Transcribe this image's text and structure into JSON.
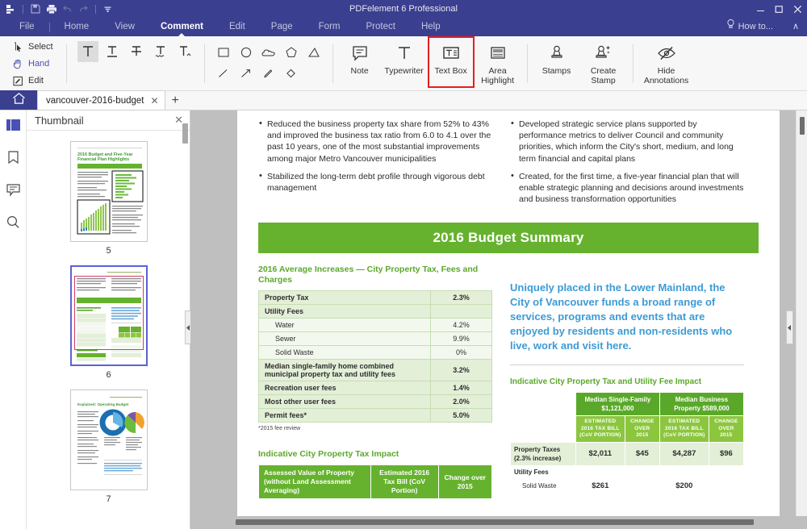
{
  "window": {
    "title": "PDFelement 6 Professional",
    "minimize": "–",
    "maximize": "☐",
    "close": "✕"
  },
  "quick_access": {
    "app_icon": "pdfelement-logo-icon",
    "save_icon": "save-icon",
    "print_icon": "print-icon",
    "undo_icon": "undo-icon",
    "redo_icon": "redo-icon",
    "customize_icon": "customize-quick-access-icon"
  },
  "menu": {
    "items": [
      {
        "label": "File",
        "active": false
      },
      {
        "label": "Home",
        "active": false
      },
      {
        "label": "View",
        "active": false
      },
      {
        "label": "Comment",
        "active": true
      },
      {
        "label": "Edit",
        "active": false
      },
      {
        "label": "Page",
        "active": false
      },
      {
        "label": "Form",
        "active": false
      },
      {
        "label": "Protect",
        "active": false
      },
      {
        "label": "Help",
        "active": false
      }
    ],
    "how_to": "How to...",
    "collapse_ribbon": "∧"
  },
  "ribbon": {
    "select_tools": [
      {
        "label": "Select",
        "icon": "cursor-select-icon",
        "active": false
      },
      {
        "label": "Hand",
        "icon": "hand-icon",
        "active": true
      },
      {
        "label": "Edit",
        "icon": "edit-pencil-icon",
        "active": false
      }
    ],
    "markup_tools": [
      {
        "icon": "highlight-text-icon",
        "selected": true
      },
      {
        "icon": "underline-text-icon",
        "selected": false
      },
      {
        "icon": "strikethrough-text-icon",
        "selected": false
      },
      {
        "icon": "squiggly-underline-icon",
        "selected": false
      },
      {
        "icon": "caret-insert-text-icon",
        "selected": false
      }
    ],
    "shape_tools": [
      {
        "icon": "rectangle-icon"
      },
      {
        "icon": "ellipse-icon"
      },
      {
        "icon": "cloud-icon"
      },
      {
        "icon": "polygon-icon"
      },
      {
        "icon": "open-polygon-icon"
      },
      {
        "icon": "line-icon"
      },
      {
        "icon": "arrow-icon"
      },
      {
        "icon": "pencil-draw-icon"
      },
      {
        "icon": "eraser-icon"
      }
    ],
    "buttons": [
      {
        "label": "Note",
        "icon": "sticky-note-icon",
        "highlighted": false
      },
      {
        "label": "Typewriter",
        "icon": "typewriter-icon",
        "highlighted": false
      },
      {
        "label": "Text Box",
        "icon": "text-box-icon",
        "highlighted": true
      },
      {
        "label": "Area\nHighlight",
        "icon": "area-highlight-icon",
        "highlighted": false
      },
      {
        "label": "Stamps",
        "icon": "stamp-icon",
        "highlighted": false
      },
      {
        "label": "Create\nStamp",
        "icon": "create-stamp-icon",
        "highlighted": false
      },
      {
        "label": "Hide\nAnnotations",
        "icon": "hide-annotations-icon",
        "highlighted": false
      }
    ],
    "accent_highlight_color": "#e81d1d"
  },
  "tabs": {
    "home_icon": "home-icon",
    "document_tab": "vancouver-2016-budget",
    "close_tab": "✕",
    "new_tab": "+"
  },
  "rail": {
    "items": [
      {
        "icon": "thumbnail-panel-icon",
        "active": true
      },
      {
        "icon": "bookmark-icon",
        "active": false
      },
      {
        "icon": "annotation-comment-icon",
        "active": false
      },
      {
        "icon": "search-icon",
        "active": false
      }
    ]
  },
  "thumbnail_panel": {
    "title": "Thumbnail",
    "close": "✕",
    "pages": [
      {
        "number": "5",
        "selected": false
      },
      {
        "number": "6",
        "selected": true
      },
      {
        "number": "7",
        "selected": false
      }
    ]
  },
  "document": {
    "left_bullets": [
      "Reduced the business property tax share from 52% to 43% and improved the business tax ratio from 6.0 to 4.1 over the past 10 years, one of the most substantial improvements among major Metro Vancouver municipalities",
      "Stabilized the long-term debt profile through vigorous debt management"
    ],
    "right_bullets": [
      "Developed strategic service plans supported by performance metrics to deliver Council and community priorities, which inform the City's short, medium, and long term financial and capital plans",
      "Created, for the first time, a five-year financial plan that will enable strategic planning and decisions around investments and business transformation opportunities"
    ],
    "banner_title": "2016 Budget Summary",
    "avg_increases": {
      "heading": "2016 Average Increases — City Property Tax, Fees and Charges",
      "rows": [
        {
          "label": "Property Tax",
          "value": "2.3%",
          "style": "lt"
        },
        {
          "label": "Utility Fees",
          "value": "",
          "style": "lt"
        },
        {
          "label": "Water",
          "value": "4.2%",
          "style": "wh"
        },
        {
          "label": "Sewer",
          "value": "9.9%",
          "style": "wh"
        },
        {
          "label": "Solid Waste",
          "value": "0%",
          "style": "wh"
        },
        {
          "label": "Median single-family home combined municipal property tax and utility fees",
          "value": "3.2%",
          "style": "lt"
        },
        {
          "label": "Recreation user fees",
          "value": "1.4%",
          "style": "lt"
        },
        {
          "label": "Most other user fees",
          "value": "2.0%",
          "style": "lt"
        },
        {
          "label": "Permit fees*",
          "value": "5.0%",
          "style": "lt"
        }
      ],
      "footnote": "*2015 fee review"
    },
    "quote": "Uniquely placed in the Lower Mainland, the City of Vancouver funds a broad range of services, programs and events that are enjoyed by residents and non-residents who live, work and visit here.",
    "impact_table": {
      "heading": "Indicative City Property Tax and Utility Fee Impact",
      "group_headers": [
        "Median Single-Family $1,121,000",
        "Median Business Property $589,000"
      ],
      "sub_headers": [
        "ESTIMATED 2016 TAX BILL (CoV PORTION)",
        "CHANGE OVER 2015",
        "ESTIMATED 2016 TAX BILL (CoV PORTION)",
        "CHANGE OVER 2015"
      ],
      "rows": [
        {
          "label": "Property Taxes (2.3% increase)",
          "values": [
            "$2,011",
            "$45",
            "$4,287",
            "$96"
          ],
          "style": "shaded"
        },
        {
          "label": "Utility Fees",
          "values": [
            "",
            "",
            "",
            ""
          ],
          "style": "plain"
        },
        {
          "label": "Solid Waste",
          "values": [
            "$261",
            "",
            "$200",
            ""
          ],
          "style": "plain"
        }
      ]
    },
    "indicative_tax": {
      "heading": "Indicative City Property Tax Impact",
      "headers": [
        "Assessed Value of Property (without Land Assessment Averaging)",
        "Estimated 2016 Tax Bill (CoV Portion)",
        "Change over 2015"
      ]
    }
  },
  "colors": {
    "brand_navy": "#3b3f8f",
    "doc_green": "#66b22e",
    "doc_green_light": "#8cc63f",
    "quote_blue": "#3c9bd6",
    "ribbon_bg": "#f7f7f7"
  }
}
